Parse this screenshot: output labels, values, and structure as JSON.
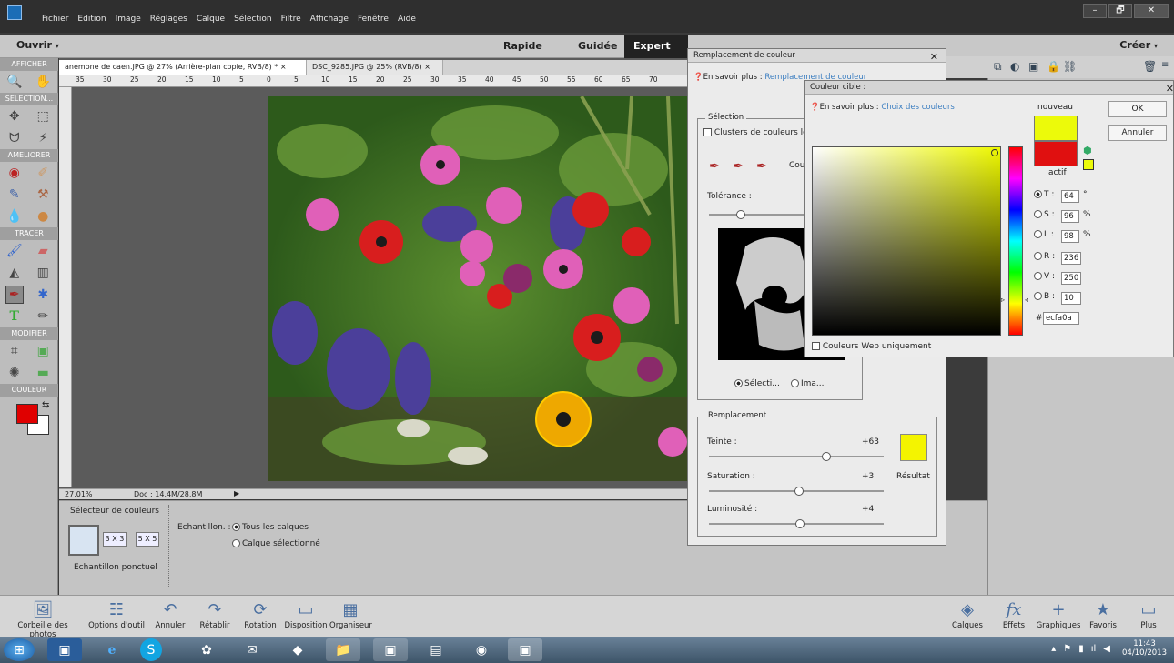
{
  "menubar": {
    "items": [
      "Fichier",
      "Edition",
      "Image",
      "Réglages",
      "Calque",
      "Sélection",
      "Filtre",
      "Affichage",
      "Fenêtre",
      "Aide"
    ],
    "win_min": "–",
    "win_max": "🗗",
    "win_close": "✕"
  },
  "modebar": {
    "open_label": "Ouvrir",
    "modes": [
      "Rapide",
      "Guidée",
      "Expert"
    ],
    "active_mode": "Expert",
    "create_label": "Créer"
  },
  "toolbox": {
    "sections": [
      "AFFICHER",
      "SELECTION...",
      "AMELIORER",
      "TRACER",
      "MODIFIER",
      "COULEUR"
    ],
    "foreground_color": "#e00000",
    "background_color": "#ffffff"
  },
  "document": {
    "tabs": [
      "anemone de caen.JPG @ 27% (Arrière-plan copie, RVB/8) *",
      "DSC_9285.JPG @ 25% (RVB/8)"
    ],
    "ruler_ticks": [
      "35",
      "30",
      "25",
      "20",
      "15",
      "10",
      "5",
      "0",
      "5",
      "10",
      "15",
      "20",
      "25",
      "30",
      "35",
      "40",
      "45",
      "50",
      "55",
      "60",
      "65",
      "70"
    ],
    "zoom": "27,01%",
    "doc_size": "Doc : 14,4M/28,8M"
  },
  "options": {
    "tool_name": "Sélecteur de couleurs",
    "sample_sizes": [
      "3 X 3",
      "5 X 5"
    ],
    "sample_label": "Echantillon ponctuel",
    "echantillon_label": "Echantillon. :",
    "radio_all": "Tous les calques",
    "radio_selected": "Calque sélectionné"
  },
  "replace_dialog": {
    "title": "Remplacement de couleur",
    "learn_more": "En savoir plus :",
    "learn_link": "Remplacement de couleur",
    "selection_group": "Sélection",
    "clusters_label": "Clusters de couleurs lo",
    "color_label_cut": "Cou",
    "tolerance_label": "Tolérance :",
    "radio_selection": "Sélecti...",
    "radio_image": "Ima...",
    "replacement_group": "Remplacement",
    "hue_label": "Teinte :",
    "hue_value": "+63",
    "saturation_label": "Saturation :",
    "saturation_value": "+3",
    "lightness_label": "Luminosité :",
    "lightness_value": "+4",
    "result_label": "Résultat",
    "result_color": "#f4f400"
  },
  "color_picker": {
    "title": "Couleur cible :",
    "learn_more": "En savoir plus :",
    "learn_link": "Choix des couleurs",
    "new_label": "nouveau",
    "active_label": "actif",
    "new_color": "#ecfa0a",
    "active_color": "#e01010",
    "ok_label": "OK",
    "cancel_label": "Annuler",
    "fields": [
      {
        "key": "T :",
        "value": "64",
        "unit": "°",
        "selected": true
      },
      {
        "key": "S :",
        "value": "96",
        "unit": "%",
        "selected": false
      },
      {
        "key": "L :",
        "value": "98",
        "unit": "%",
        "selected": false
      },
      {
        "key": "R :",
        "value": "236",
        "unit": "",
        "selected": false
      },
      {
        "key": "V :",
        "value": "250",
        "unit": "",
        "selected": false
      },
      {
        "key": "B :",
        "value": "10",
        "unit": "",
        "selected": false
      }
    ],
    "hex_prefix": "#",
    "hex_value": "ecfa0a",
    "web_colors_label": "Couleurs Web uniquement"
  },
  "bottombar": {
    "left_items": [
      "Corbeille des photos",
      "Options d'outil",
      "Annuler",
      "Rétablir",
      "Rotation",
      "Disposition",
      "Organiseur"
    ],
    "right_items": [
      "Calques",
      "Effets",
      "Graphiques",
      "Favoris",
      "Plus"
    ]
  },
  "taskbar": {
    "time": "11:43",
    "date": "04/10/2013"
  }
}
